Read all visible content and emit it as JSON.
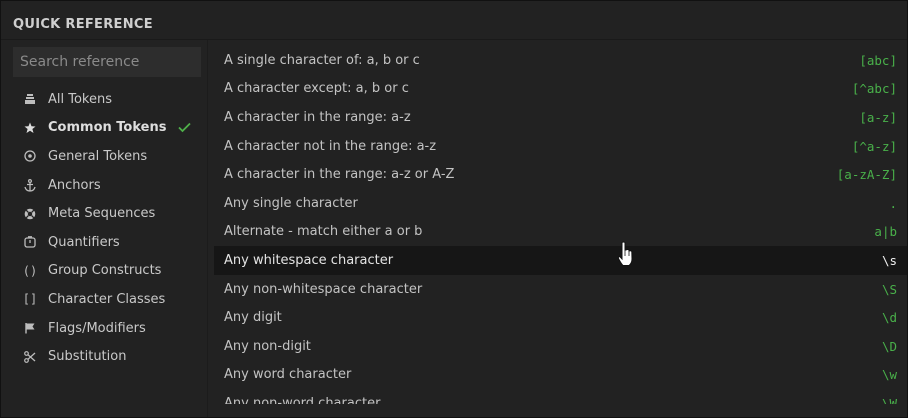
{
  "header": {
    "title": "QUICK REFERENCE"
  },
  "search": {
    "placeholder": "Search reference"
  },
  "sidebar": {
    "items": [
      {
        "label": "All Tokens",
        "icon": "stack-icon"
      },
      {
        "label": "Common Tokens",
        "icon": "star-icon",
        "active": true
      },
      {
        "label": "General Tokens",
        "icon": "target-icon"
      },
      {
        "label": "Anchors",
        "icon": "anchor-icon"
      },
      {
        "label": "Meta Sequences",
        "icon": "lifebuoy-icon"
      },
      {
        "label": "Quantifiers",
        "icon": "timer-icon"
      },
      {
        "label": "Group Constructs",
        "icon": "parentheses-icon",
        "glyph": "()"
      },
      {
        "label": "Character Classes",
        "icon": "brackets-icon",
        "glyph": "[]"
      },
      {
        "label": "Flags/Modifiers",
        "icon": "flag-icon"
      },
      {
        "label": "Substitution",
        "icon": "scissors-icon"
      }
    ]
  },
  "rows": [
    {
      "desc": "A single character of: a, b or c",
      "token": "[abc]"
    },
    {
      "desc": "A character except: a, b or c",
      "token": "[^abc]"
    },
    {
      "desc": "A character in the range: a-z",
      "token": "[a-z]"
    },
    {
      "desc": "A character not in the range: a-z",
      "token": "[^a-z]"
    },
    {
      "desc": "A character in the range: a-z or A-Z",
      "token": "[a-zA-Z]"
    },
    {
      "desc": "Any single character",
      "token": "."
    },
    {
      "desc": "Alternate - match either a or b",
      "token": "a|b"
    },
    {
      "desc": "Any whitespace character",
      "token": "\\s",
      "highlight": true
    },
    {
      "desc": "Any non-whitespace character",
      "token": "\\S"
    },
    {
      "desc": "Any digit",
      "token": "\\d"
    },
    {
      "desc": "Any non-digit",
      "token": "\\D"
    },
    {
      "desc": "Any word character",
      "token": "\\w"
    },
    {
      "desc": "Any non-word character",
      "token": "\\W"
    }
  ],
  "colors": {
    "token": "#49b04a",
    "check": "#4fb04a",
    "background": "#222222"
  }
}
